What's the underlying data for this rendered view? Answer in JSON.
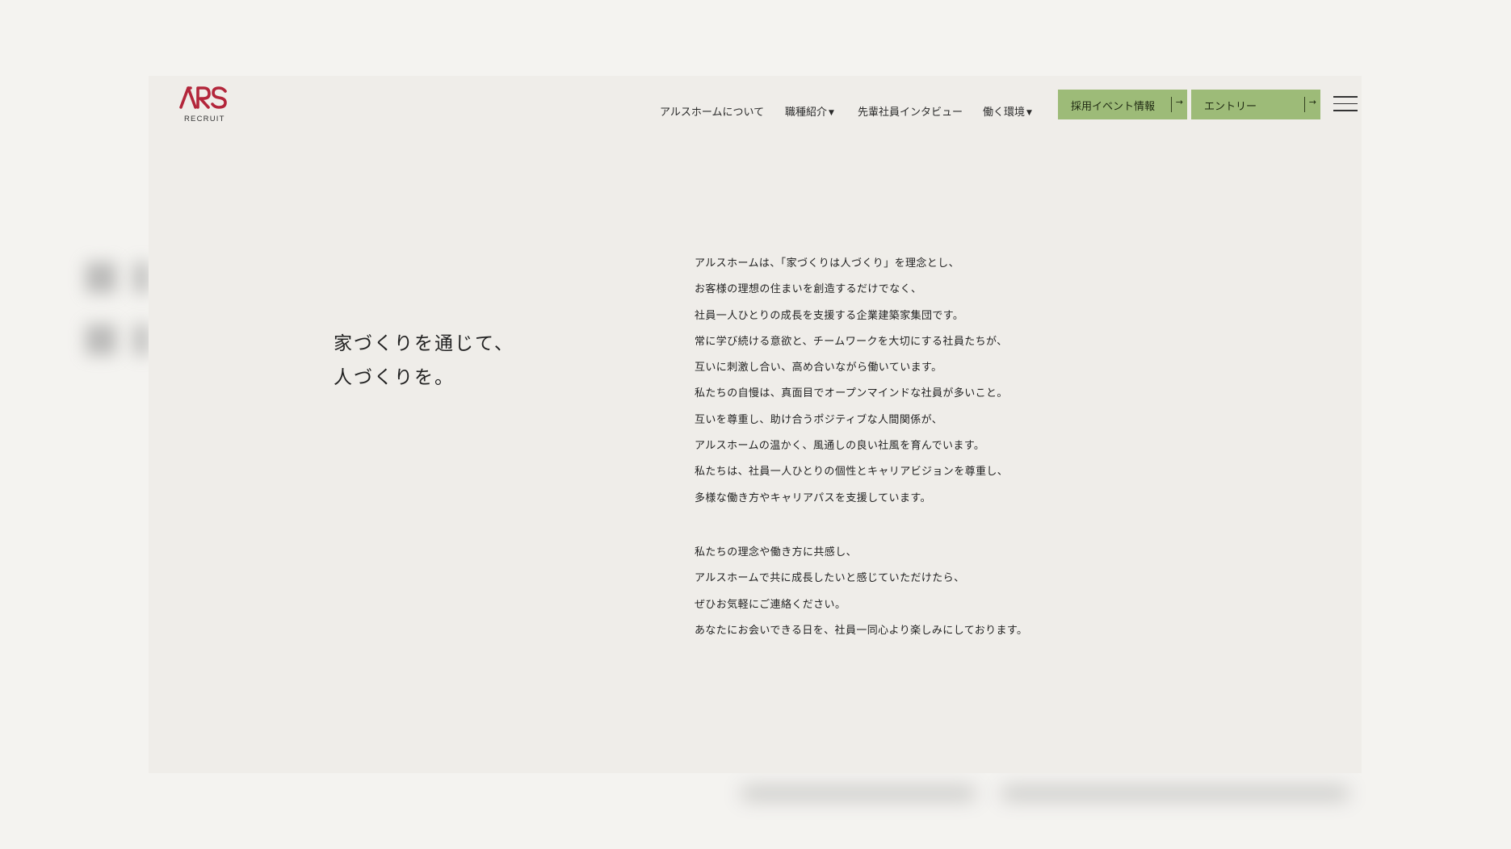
{
  "header": {
    "logo_text": "ARS",
    "logo_subtitle": "RECRUIT",
    "brand_color": "#b3263b",
    "nav": [
      {
        "label": "アルスホームについて",
        "dropdown": false
      },
      {
        "label": "職種紹介",
        "dropdown": true
      },
      {
        "label": "先輩社員インタビュー",
        "dropdown": false
      },
      {
        "label": "働く環境",
        "dropdown": true
      }
    ],
    "dropdown_caret": "▼",
    "buttons": [
      {
        "label": "採用イベント情報",
        "arrow": "→"
      },
      {
        "label": "エントリー",
        "arrow": "→"
      }
    ],
    "button_color": "#9dbb78",
    "menu_icon": "hamburger-icon"
  },
  "main": {
    "headline": [
      "家づくりを通じて、",
      "人づくりを。"
    ],
    "paragraphs": [
      [
        "アルスホームは、「家づくりは人づくり」を理念とし、",
        "お客様の理想の住まいを創造するだけでなく、",
        "社員一人ひとりの成長を支援する企業建築家集団です。",
        "常に学び続ける意欲と、チームワークを大切にする社員たちが、",
        "互いに刺激し合い、高め合いながら働いています。",
        "私たちの自慢は、真面目でオープンマインドな社員が多いこと。",
        "互いを尊重し、助け合うポジティブな人間関係が、",
        "アルスホームの温かく、風通しの良い社風を育んでいます。",
        "私たちは、社員一人ひとりの個性とキャリアビジョンを尊重し、",
        "多様な働き方やキャリアパスを支援しています。"
      ],
      [
        "私たちの理念や働き方に共感し、",
        "アルスホームで共に成長したいと感じていただけたら、",
        "ぜひお気軽にご連絡ください。",
        "あなたにお会いできる日を、社員一同心より楽しみにしております。"
      ]
    ]
  }
}
